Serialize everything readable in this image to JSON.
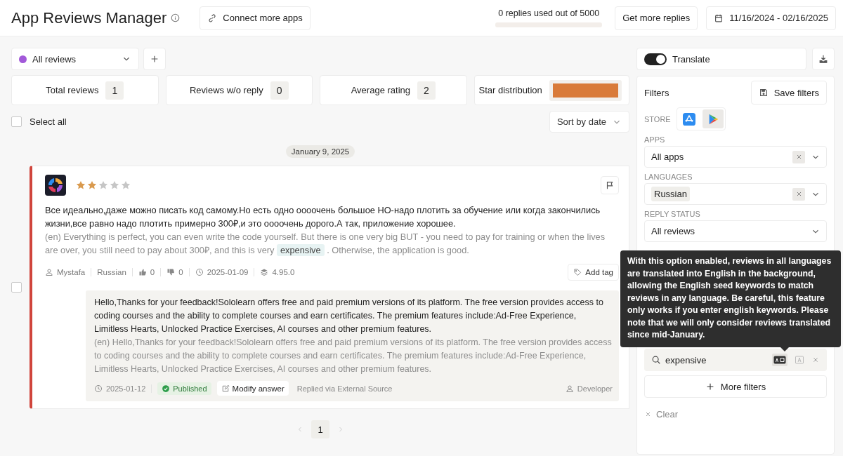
{
  "header": {
    "title": "App Reviews Manager",
    "connect_button": "Connect more apps",
    "usage": {
      "text": "0 replies used out of 5000",
      "level": 0
    },
    "get_more_button": "Get more replies",
    "date_range": "11/16/2024 - 02/16/2025"
  },
  "review_filter": {
    "value": "All reviews",
    "color": "#a259d9"
  },
  "stats": [
    {
      "label": "Total reviews",
      "value": "1"
    },
    {
      "label": "Reviews w/o reply",
      "value": "0"
    },
    {
      "label": "Average rating",
      "value": "2"
    }
  ],
  "star_distribution": {
    "label": "Star distribution"
  },
  "select_all": {
    "label": "Select all",
    "checked": false
  },
  "sort": {
    "value": "Sort by date"
  },
  "date_group": "January 9, 2025",
  "reviews": [
    {
      "stars": 2,
      "checked": false,
      "text": "Все идеально,даже можно писать код самому.Но есть одно оооочень большое НО-надо плотить за обучение или когда закончились жизни,все равно надо плотить примерно 300₽,и это оооочень дорого.А так, приложение хорошее.",
      "translation": {
        "before": "(en) Everything is perfect, you can even write the code yourself. But there is one very big BUT - you need to pay for training or when the lives are over, you still need to pay about 300₽, and this is very",
        "match": "expensive",
        "after": ". Otherwise, the application is good."
      },
      "meta": {
        "author": "Mystafa",
        "language": "Russian",
        "likes": "0",
        "dislikes": "0",
        "date": "2025-01-09",
        "version": "4.95.0"
      },
      "add_tag": "Add tag",
      "reply": {
        "text": "Hello,Thanks for your feedback!Sololearn offers free and paid premium versions of its platform. The free version provides access to coding courses and the ability to complete courses and earn certificates. The premium features include:Ad-Free Experience, Limitless Hearts, Unlocked Practice Exercises, AI courses and other premium features.",
        "translation": "(en) Hello,Thanks for your feedback!Sololearn offers free and paid premium versions of its platform. The free version provides access to coding courses and the ability to complete courses and earn certificates. The premium features include:Ad-Free Experience, Limitless Hearts, Unlocked Practice Exercises, AI courses and other premium features.",
        "date": "2025-01-12",
        "status": "Published",
        "modify_button": "Modify answer",
        "source": "Replied via External Source",
        "author": "Developer"
      }
    }
  ],
  "pagination": {
    "pages": [
      {
        "label": "1",
        "selected": true
      }
    ]
  },
  "translate": {
    "label": "Translate",
    "on": true
  },
  "filters": {
    "title": "Filters",
    "save_button": "Save filters",
    "store": {
      "label": "STORE",
      "options": [
        {
          "kind": "app-store",
          "selected": false
        },
        {
          "kind": "play-store",
          "selected": true
        }
      ]
    },
    "fields": [
      {
        "label": "APPS",
        "value": "All apps",
        "clearable": true
      },
      {
        "label": "LANGUAGES",
        "chips": [
          "Russian"
        ],
        "clearable": true
      },
      {
        "label": "REPLY STATUS",
        "value": "All reviews",
        "clearable": false
      }
    ],
    "keywords": {
      "value": "expensive",
      "modes": [
        {
          "kind": "translated",
          "selected": true
        },
        {
          "kind": "original",
          "selected": false
        }
      ]
    },
    "more_filters": "More filters",
    "clear": "Clear"
  },
  "tooltip": "With this option enabled, reviews in all languages are translated into English in the background, allowing the English seed keywords to match reviews in any language. Be careful, this feature only works if you enter english keywords. Please note that we will only consider reviews translated since mid-January."
}
